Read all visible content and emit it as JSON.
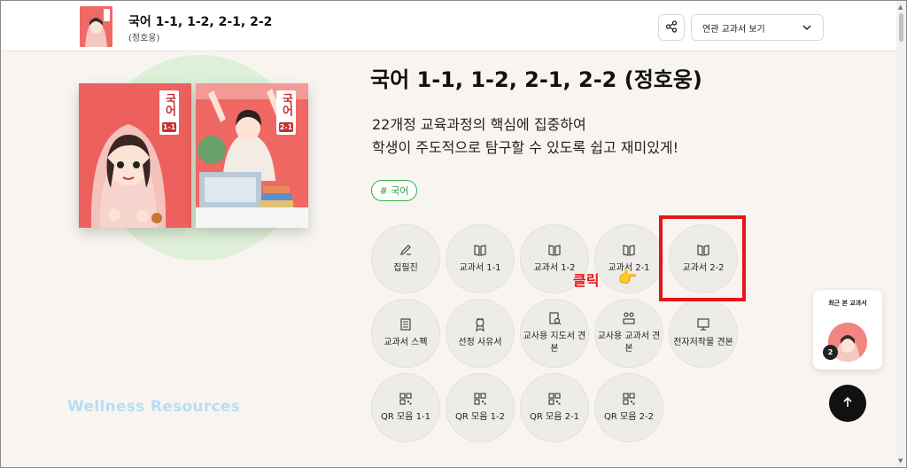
{
  "header": {
    "title": "국어 1-1, 1-2, 2-1, 2-2",
    "author": "(정호웅)",
    "share_icon": "share-icon",
    "related_label": "연관 교과서 보기"
  },
  "hero": {
    "title": "국어 1-1, 1-2, 2-1, 2-2 (정호웅)",
    "desc_line1": "22개정 교육과정의 핵심에 집중하여",
    "desc_line2": "학생이 주도적으로 탐구할 수 있도록 쉽고 재미있게!",
    "tag": "# 국어",
    "book1": {
      "title": "국어",
      "vol": "1-1"
    },
    "book2": {
      "title": "국어",
      "vol": "2-1"
    },
    "watermark": "Wellness Resources"
  },
  "buttons": [
    {
      "label": "집필진",
      "icon": "pen-icon"
    },
    {
      "label": "교과서 1-1",
      "icon": "book-icon"
    },
    {
      "label": "교과서 1-2",
      "icon": "book-icon"
    },
    {
      "label": "교과서 2-1",
      "icon": "book-icon"
    },
    {
      "label": "교과서 2-2",
      "icon": "book-icon"
    },
    {
      "label": "교과서 스펙",
      "icon": "spec-icon"
    },
    {
      "label": "선정 사유서",
      "icon": "award-icon"
    },
    {
      "label": "교사용 지도서 견본",
      "icon": "guide-icon"
    },
    {
      "label": "교사용 교과서 견본",
      "icon": "teacher-icon"
    },
    {
      "label": "전자저작물 견본",
      "icon": "monitor-icon"
    },
    {
      "label": "QR 모음 1-1",
      "icon": "qr-icon"
    },
    {
      "label": "QR 모음 1-2",
      "icon": "qr-icon"
    },
    {
      "label": "QR 모음 2-1",
      "icon": "qr-icon"
    },
    {
      "label": "QR 모음 2-2",
      "icon": "qr-icon"
    }
  ],
  "annotation": {
    "click_text": "클릭",
    "hand": "👉",
    "highlight_color": "#e8141a"
  },
  "recent": {
    "title": "최근 본 교과서",
    "count": "2"
  },
  "colors": {
    "accent_green": "#36b04a",
    "book_red": "#ec615d",
    "background": "#f8f5f0"
  }
}
